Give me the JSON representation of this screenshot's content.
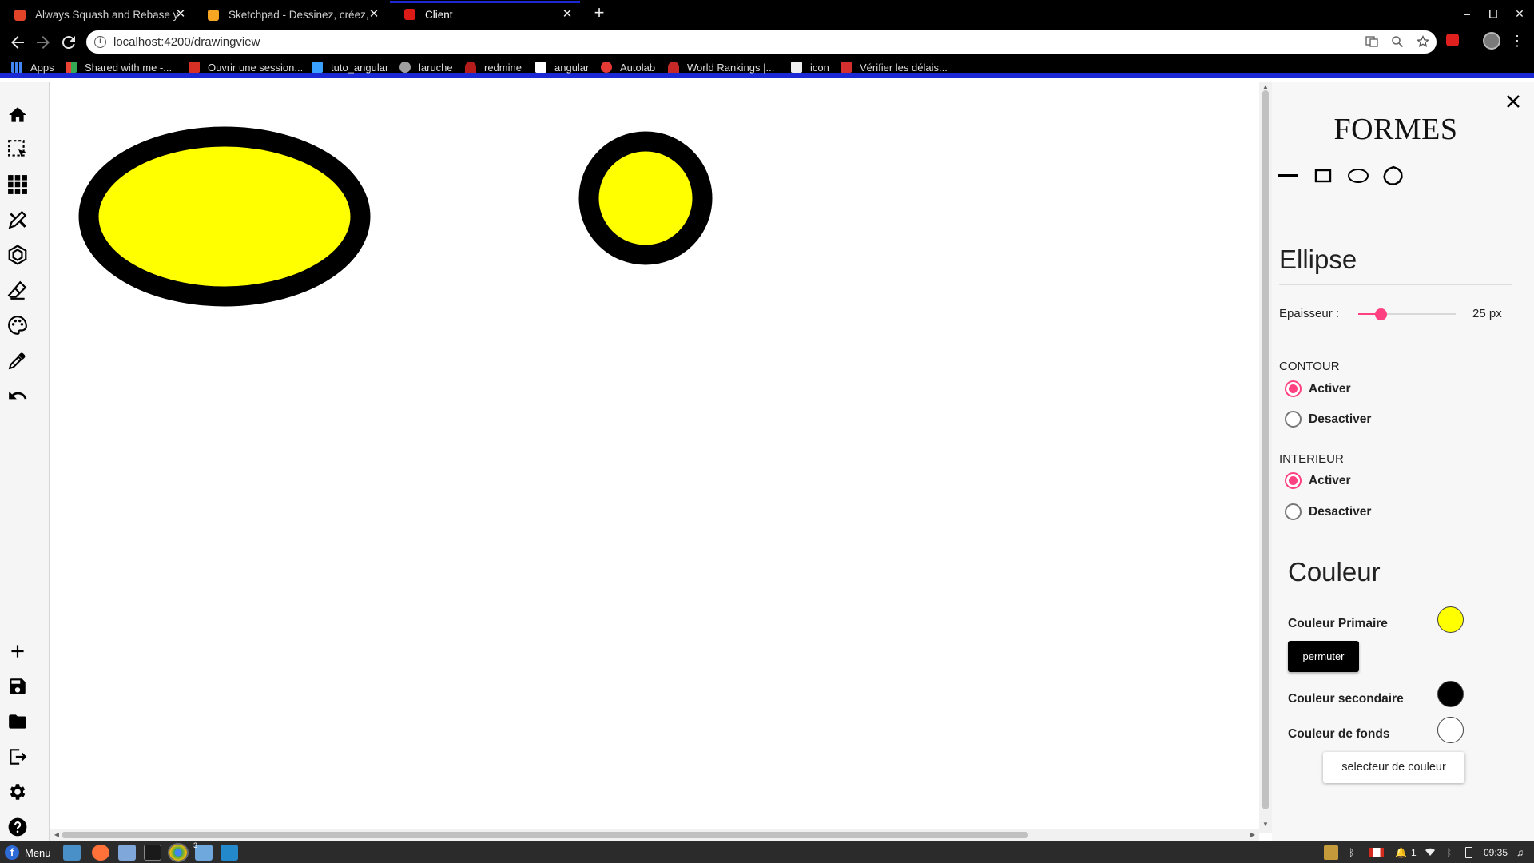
{
  "browser": {
    "tabs": [
      {
        "title": "Always Squash and Rebase you",
        "favicon_color": "#e24329",
        "active": false
      },
      {
        "title": "Sketchpad - Dessinez, créez, pa",
        "favicon_color": "#f6a623",
        "active": false
      },
      {
        "title": "Client",
        "favicon_color": "#dd1b16",
        "active": true
      }
    ],
    "new_tab": "+",
    "window_controls": {
      "minimize": "–",
      "maximize": "⧠",
      "close": "✕"
    },
    "url": "localhost:4200/drawingview",
    "bookmarks": [
      {
        "label": "Apps",
        "icon_color": "#4285f4"
      },
      {
        "label": "Shared with me -...",
        "icon_color": "#ea4335"
      },
      {
        "label": "Ouvrir une session...",
        "icon_color": "#d93025"
      },
      {
        "label": "tuto_angular",
        "icon_color": "#3aa0ff"
      },
      {
        "label": "laruche",
        "icon_color": "#9e9e9e"
      },
      {
        "label": "redmine",
        "icon_color": "#b71c1c"
      },
      {
        "label": "angular",
        "icon_color": "#ffffff"
      },
      {
        "label": "Autolab",
        "icon_color": "#e53935"
      },
      {
        "label": "World Rankings |...",
        "icon_color": "#c62828"
      },
      {
        "label": "icon",
        "icon_color": "#eeeeee"
      },
      {
        "label": "Vérifier les délais...",
        "icon_color": "#d32f2f"
      }
    ]
  },
  "sidebar": {
    "top_tools": [
      "home-icon",
      "selection-icon",
      "grid-icon",
      "pencil-brush-icon",
      "polygon-icon",
      "eraser-icon",
      "palette-icon",
      "pipette-icon",
      "undo-icon"
    ],
    "bottom_tools": [
      "plus-icon",
      "save-icon",
      "folder-icon",
      "export-icon",
      "gear-icon",
      "help-icon"
    ]
  },
  "canvas": {
    "shapes": [
      {
        "type": "ellipse",
        "fill": "#ffff00",
        "stroke": "#000000"
      },
      {
        "type": "circle",
        "fill": "#ffff00",
        "stroke": "#000000"
      }
    ]
  },
  "panel": {
    "title": "FORMES",
    "shape_buttons": [
      "line-icon",
      "rectangle-icon",
      "ellipse-icon",
      "polygon-icon"
    ],
    "section_title": "Ellipse",
    "thickness_label": "Epaisseur :",
    "thickness_value": "25 px",
    "thickness_slider_fraction": 0.24,
    "contour_label": "CONTOUR",
    "contour_options": [
      "Activer",
      "Desactiver"
    ],
    "contour_selected": "Activer",
    "interior_label": "INTERIEUR",
    "interior_options": [
      "Activer",
      "Desactiver"
    ],
    "interior_selected": "Activer",
    "color_section_title": "Couleur",
    "primary_color_label": "Couleur Primaire",
    "primary_color": "#ffff00",
    "swap_button": "permuter",
    "secondary_color_label": "Couleur secondaire",
    "secondary_color": "#000000",
    "background_color_label": "Couleur de fonds",
    "background_color": "#ffffff",
    "color_picker_button": "selecteur de couleur",
    "accent_color": "#ff4081"
  },
  "taskbar": {
    "menu_label": "Menu",
    "apps": [
      "files-icon",
      "firefox-icon",
      "mail-icon",
      "terminal-icon",
      "chrome-icon",
      "folder-icon",
      "vscode-icon"
    ],
    "folder_badge": "3",
    "notifications_count": "1",
    "clock": "09:35"
  }
}
